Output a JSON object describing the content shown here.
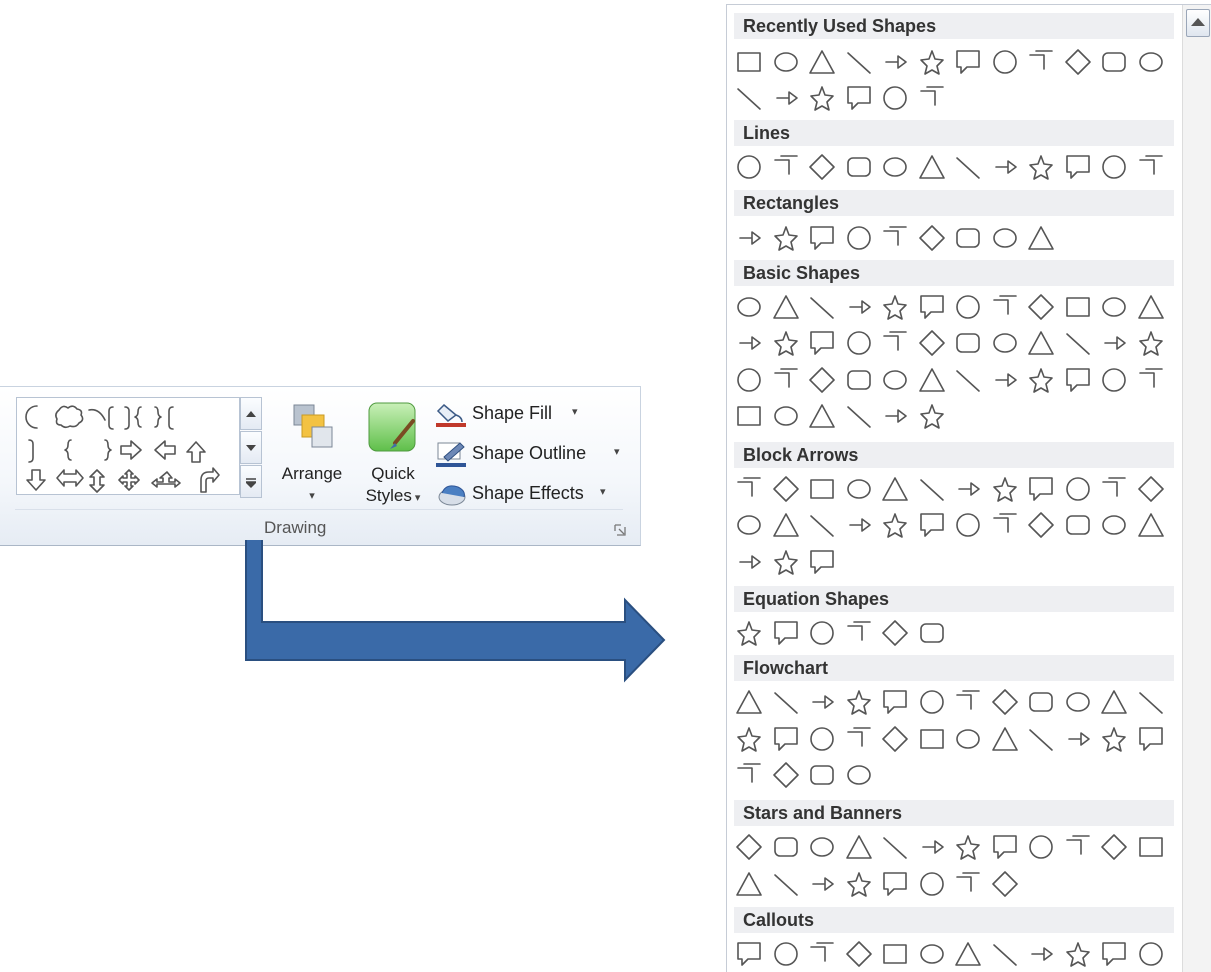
{
  "ribbon": {
    "group_label": "Drawing",
    "arrange_label_1": "Arrange",
    "quick_styles_label_1": "Quick",
    "quick_styles_label_2": "Styles",
    "shape_fill_label": "Shape Fill",
    "shape_outline_label": "Shape Outline",
    "shape_effects_label": "Shape Effects",
    "fill_color": "#c0392b",
    "outline_color": "#2f5597"
  },
  "panel": {
    "sections": [
      {
        "title": "Recently Used Shapes",
        "rows": [
          12,
          6
        ]
      },
      {
        "title": "Lines",
        "rows": [
          12
        ]
      },
      {
        "title": "Rectangles",
        "rows": [
          9
        ]
      },
      {
        "title": "Basic Shapes",
        "rows": [
          12,
          12,
          12,
          6
        ]
      },
      {
        "title": "Block Arrows",
        "rows": [
          12,
          12,
          3
        ]
      },
      {
        "title": "Equation Shapes",
        "rows": [
          6
        ]
      },
      {
        "title": "Flowchart",
        "rows": [
          12,
          12,
          4
        ]
      },
      {
        "title": "Stars and Banners",
        "rows": [
          12,
          8
        ]
      },
      {
        "title": "Callouts",
        "rows": [
          12
        ]
      }
    ]
  },
  "colors": {
    "arrow_blue": "#3a6aa8",
    "header_bg": "#eeeff2"
  },
  "icons": {
    "arrange": "arrange-icon",
    "quick_styles": "quick-styles-icon",
    "shape_fill": "paint-bucket-icon",
    "shape_outline": "pencil-icon",
    "shape_effects": "effects-icon"
  }
}
